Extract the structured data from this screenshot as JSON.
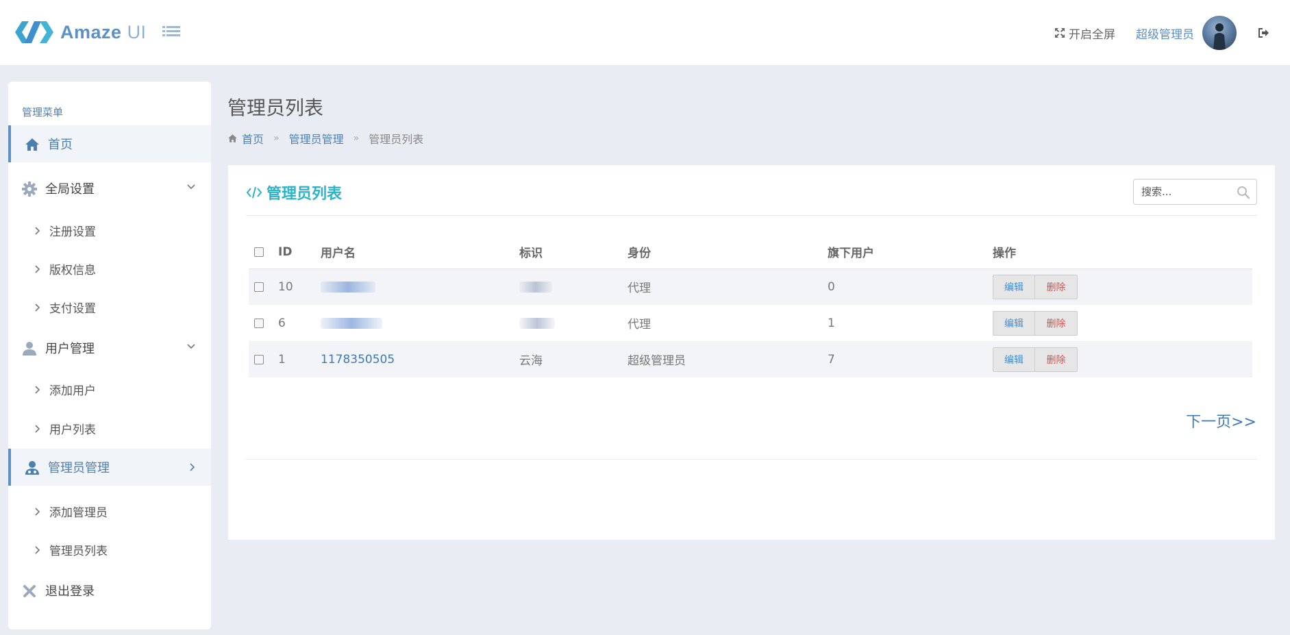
{
  "header": {
    "logo_text_bold": "Amaze",
    "logo_text_light": "UI",
    "fullscreen_label": "开启全屏",
    "user_name": "超级管理员"
  },
  "sidebar": {
    "title": "管理菜单",
    "items": [
      {
        "label": "首页",
        "icon": "home-icon",
        "active": true
      },
      {
        "label": "全局设置",
        "icon": "gear-icon"
      },
      {
        "label": "注册设置"
      },
      {
        "label": "版权信息"
      },
      {
        "label": "支付设置"
      },
      {
        "label": "用户管理",
        "icon": "user-icon"
      },
      {
        "label": "添加用户"
      },
      {
        "label": "用户列表"
      },
      {
        "label": "管理员管理",
        "icon": "admin-icon",
        "active": true
      },
      {
        "label": "添加管理员"
      },
      {
        "label": "管理员列表"
      },
      {
        "label": "退出登录",
        "icon": "close-icon"
      }
    ]
  },
  "page": {
    "title": "管理员列表",
    "breadcrumb": [
      "首页",
      "管理员管理",
      "管理员列表"
    ],
    "breadcrumb_sep": "»"
  },
  "panel": {
    "title": "管理员列表",
    "search_placeholder": "搜索...",
    "columns": [
      "ID",
      "用户名",
      "标识",
      "身份",
      "旗下用户",
      "操作"
    ],
    "rows": [
      {
        "id": "10",
        "username": "",
        "tag": "",
        "role": "代理",
        "subusers": "0",
        "redacted": true
      },
      {
        "id": "6",
        "username": "",
        "tag": "",
        "role": "代理",
        "subusers": "1",
        "redacted": true
      },
      {
        "id": "1",
        "username": "1178350505",
        "tag": "云海",
        "role": "超级管理员",
        "subusers": "7",
        "redacted": false
      }
    ],
    "edit_label": "编辑",
    "delete_label": "删除",
    "next_page_label": "下一页>>"
  },
  "colors": {
    "accent": "#5d8fc4",
    "panel_title": "#2db3c9",
    "link": "#3f78b5",
    "delete": "#d9534f",
    "background": "#e9ecf3"
  }
}
